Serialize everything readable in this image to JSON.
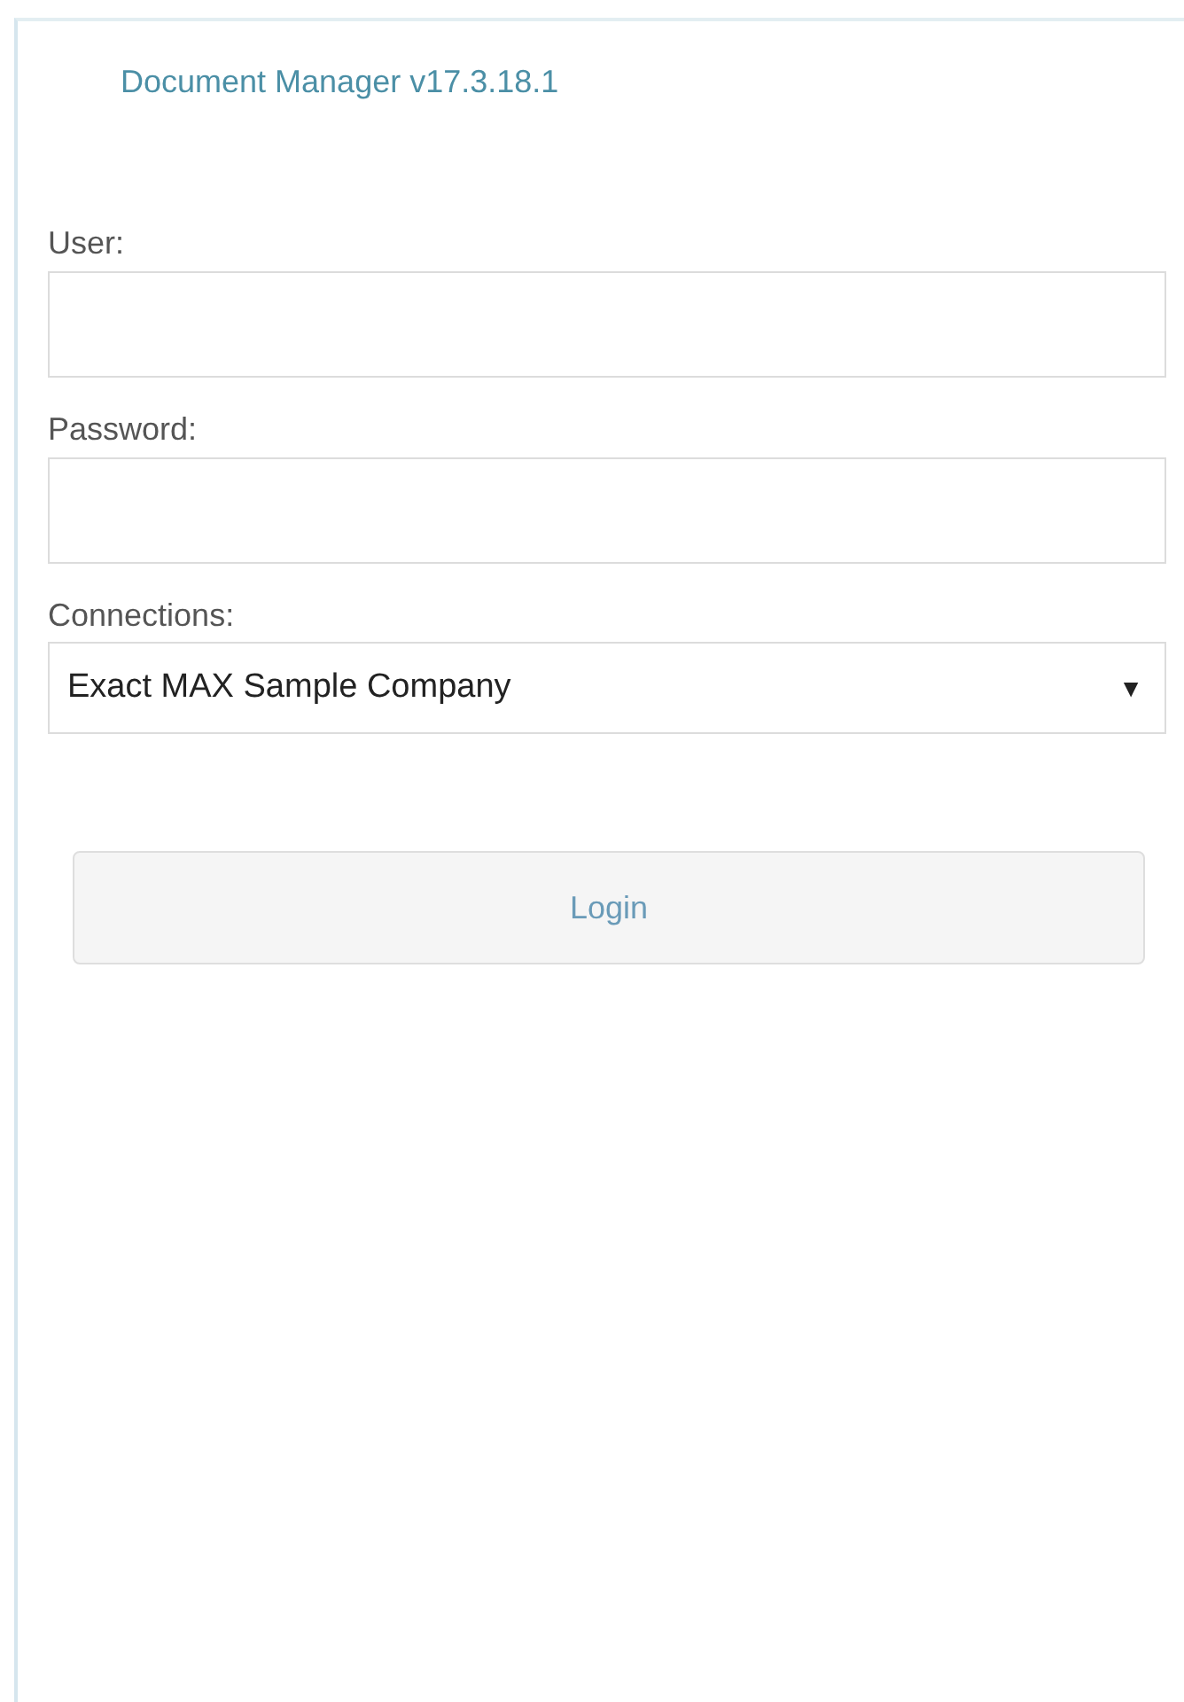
{
  "title": "Document Manager v17.3.18.1",
  "fields": [
    {
      "kind": "text",
      "label": "User:"
    },
    {
      "kind": "password",
      "label": "Password:"
    },
    {
      "kind": "select",
      "label": "Connections:",
      "value": "Exact MAX Sample Company",
      "arrow": "▼"
    }
  ],
  "button": "Login"
}
